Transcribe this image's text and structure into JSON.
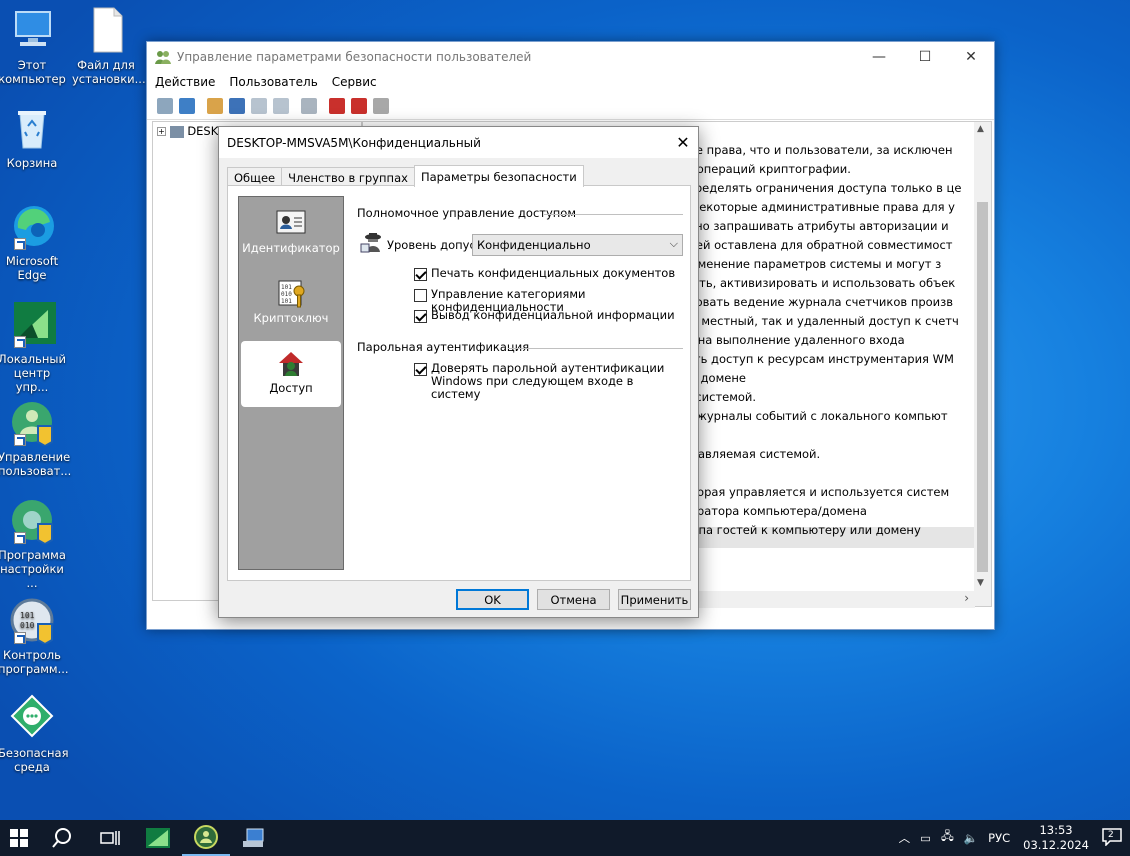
{
  "desktop": {
    "icons": [
      {
        "label": "Этот компьютер",
        "icon": "computer-icon"
      },
      {
        "label": "Файл для установки...",
        "icon": "file-icon"
      },
      {
        "label": "Корзина",
        "icon": "recycle-bin-icon"
      },
      {
        "label": "Microsoft Edge",
        "icon": "edge-icon"
      },
      {
        "label": "Локальный центр упр...",
        "icon": "local-center-icon"
      },
      {
        "label": "Управление пользоват...",
        "icon": "user-management-icon"
      },
      {
        "label": "Программа настройки ...",
        "icon": "settings-program-icon"
      },
      {
        "label": "Контроль программ...",
        "icon": "program-control-icon"
      },
      {
        "label": "Безопасная среда",
        "icon": "safe-environment-icon"
      }
    ]
  },
  "mmc": {
    "title": "Управление параметрами безопасности пользователей",
    "menu": [
      "Действие",
      "Пользователь",
      "Сервис"
    ],
    "tree_root": "DESKTOP-MMSVA5M",
    "rows": [
      "еют те же права, что и пользователи, за исключен",
      "олнение операций криптографии.",
      "т переопределять ограничения доступа только в це",
      "т иметь некоторые административные права для у",
      "т удаленно запрашивать атрибуты авторизации и",
      "ьзователей оставлена для обратной совместимост",
      "рав на изменение параметров системы и могут з",
      "т запускать, активизировать и использовать объек",
      "т планировать ведение журнала счетчиков произв",
      "меют как местный, так и удаленный доступ к счетч",
      "от право на выполнение удаленного входа",
      "т получать доступ к ресурсам инструментария WM",
      "файлов в домене",
      "вляются системой.",
      "т читать журналы событий с локального компьют",
      "",
      "теля, управляемая системой.",
      "",
      "теля, которая управляется и используется систем",
      "сь администратора компьютера/домена",
      "сь для доступа гостей к компьютеру или домену"
    ]
  },
  "dialog": {
    "title": "DESKTOP-MMSVA5M\\Конфиденциальный",
    "tabs": [
      "Общее",
      "Членство в группах",
      "Параметры безопасности"
    ],
    "side_items": [
      "Идентификатор",
      "Криптоключ",
      "Доступ"
    ],
    "group1": "Полномочное управление доступом",
    "level_label": "Уровень допуска:",
    "level_value": "Конфиденциально",
    "checks": [
      {
        "label": "Печать конфиденциальных документов",
        "checked": true
      },
      {
        "label": "Управление категориями конфиденциальности",
        "checked": false
      },
      {
        "label": "Вывод конфиденциальной информации",
        "checked": true
      }
    ],
    "group2": "Парольная аутентификация",
    "trust_check": {
      "label": "Доверять парольной аутентификации Windows при следующем входе в систему",
      "checked": true
    },
    "buttons": {
      "ok": "OK",
      "cancel": "Отмена",
      "apply": "Применить"
    }
  },
  "taskbar": {
    "language": "РУС",
    "time": "13:53",
    "date": "03.12.2024",
    "notifications": "2"
  }
}
